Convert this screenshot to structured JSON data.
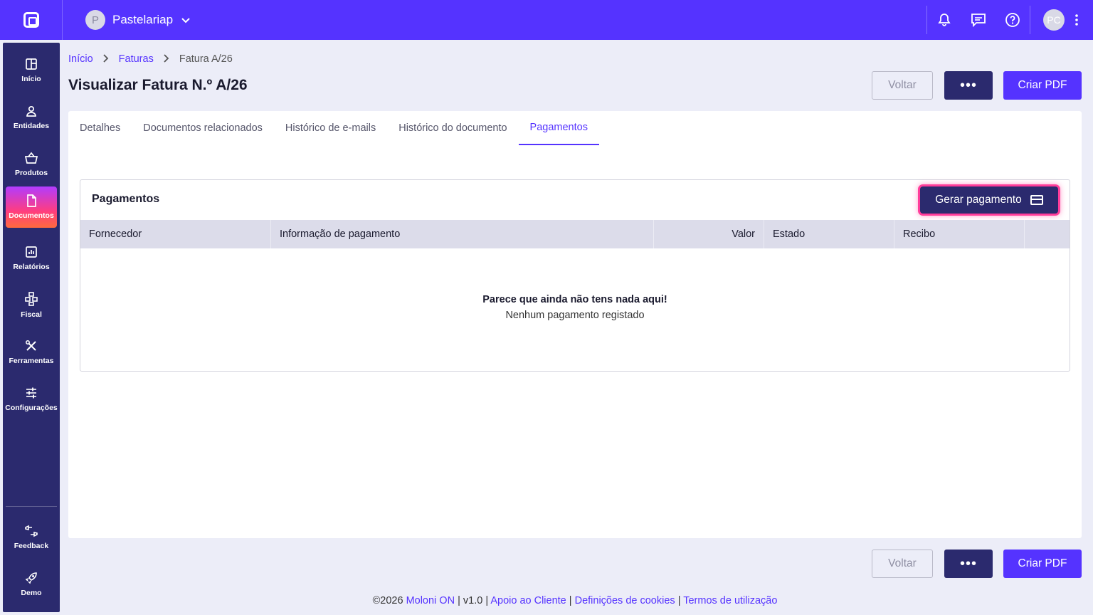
{
  "topbar": {
    "company_initial": "P",
    "company_name": "Pastelariap",
    "user_initials": "PC",
    "icons": [
      "bell-icon",
      "chat-icon",
      "help-icon"
    ]
  },
  "sidebar": {
    "items": [
      {
        "label": "Início",
        "icon": "dashboard-icon"
      },
      {
        "label": "Entidades",
        "icon": "user-icon"
      },
      {
        "label": "Produtos",
        "icon": "basket-icon"
      },
      {
        "label": "Documentos",
        "icon": "document-icon",
        "active": true
      },
      {
        "label": "Relatórios",
        "icon": "chart-icon"
      },
      {
        "label": "Fiscal",
        "icon": "hierarchy-icon"
      },
      {
        "label": "Ferramentas",
        "icon": "tools-icon"
      },
      {
        "label": "Configurações",
        "icon": "sliders-icon"
      }
    ],
    "bottom_items": [
      {
        "label": "Feedback",
        "icon": "feedback-icon"
      },
      {
        "label": "Demo",
        "icon": "rocket-icon"
      }
    ]
  },
  "breadcrumb": {
    "home": "Início",
    "section": "Faturas",
    "current": "Fatura A/26"
  },
  "page_title": "Visualizar Fatura N.º A/26",
  "actions": {
    "back_label": "Voltar",
    "more_label": "•••",
    "pdf_label": "Criar PDF"
  },
  "tabs": [
    {
      "label": "Detalhes"
    },
    {
      "label": "Documentos relacionados"
    },
    {
      "label": "Histórico de e-mails"
    },
    {
      "label": "Histórico do documento"
    },
    {
      "label": "Pagamentos",
      "active": true
    }
  ],
  "payments": {
    "title": "Pagamentos",
    "generate_label": "Gerar pagamento",
    "columns": [
      "Fornecedor",
      "Informação de pagamento",
      "Valor",
      "Estado",
      "Recibo"
    ],
    "empty_title": "Parece que ainda não tens nada aqui!",
    "empty_subtitle": "Nenhum pagamento registado"
  },
  "footer": {
    "copyright": "©2026",
    "brand": "Moloni ON",
    "version": "v1.0",
    "support": "Apoio ao Cliente",
    "cookies": "Definições de cookies",
    "terms": "Termos de utilização"
  },
  "colors": {
    "primary": "#5533ff",
    "navy": "#2b2a6e",
    "highlight": "#ff3d9a"
  }
}
